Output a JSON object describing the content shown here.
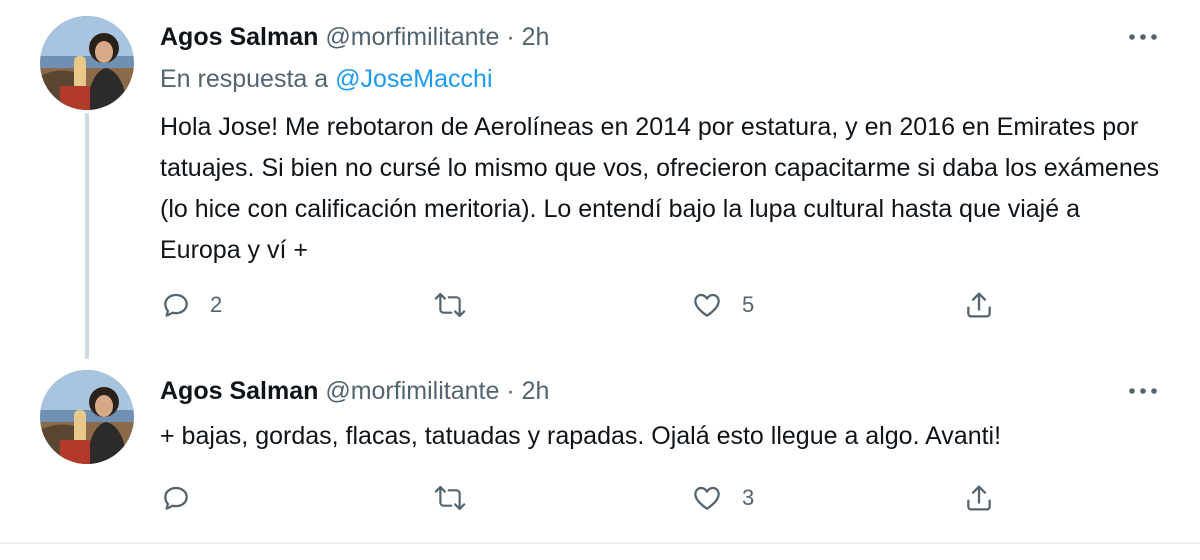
{
  "colors": {
    "text": "#0f1419",
    "secondary": "#536471",
    "link": "#1d9bf0",
    "thread_line": "#cfd9de"
  },
  "tweets": [
    {
      "name": "Agos Salman",
      "handle": "@morfimilitante",
      "separator": "·",
      "time": "2h",
      "reply_prefix": "En respuesta a",
      "reply_mention": "@JoseMacchi",
      "text": "Hola Jose! Me rebotaron de Aerolíneas en 2014 por estatura, y en 2016 en Emirates por tatuajes. Si bien no cursé lo mismo que vos, ofrecieron capacitarme si daba los exámenes (lo hice con calificación meritoria). Lo entendí bajo la lupa cultural hasta que viajé a Europa y ví +",
      "replies": "2",
      "retweets": "",
      "likes": "5"
    },
    {
      "name": "Agos Salman",
      "handle": "@morfimilitante",
      "separator": "·",
      "time": "2h",
      "text": "+ bajas, gordas, flacas, tatuadas y rapadas. Ojalá esto llegue a algo. Avanti!",
      "replies": "",
      "retweets": "",
      "likes": "3"
    }
  ],
  "icons": {
    "avatar": "avatar",
    "more": "more-dots-icon",
    "reply": "reply-icon",
    "retweet": "retweet-icon",
    "like": "heart-icon",
    "share": "share-icon"
  }
}
